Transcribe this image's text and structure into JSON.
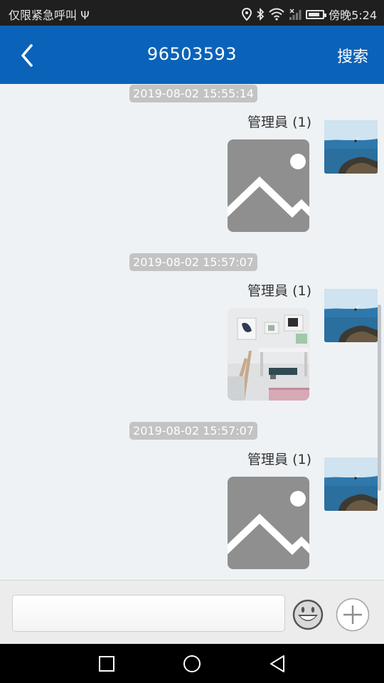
{
  "status_bar": {
    "carrier_text": "仅限紧急呼叫",
    "usb_glyph": "Ψ",
    "time_text": "傍晚5:24",
    "icons": [
      "location-icon",
      "bluetooth-icon",
      "wifi-icon",
      "cell-signal-icon",
      "battery-icon"
    ],
    "battery_level": 0.85
  },
  "header": {
    "back_icon": "chevron-left-icon",
    "title": "96503593",
    "search_label": "搜索",
    "color": "#0a63b8"
  },
  "messages": [
    {
      "timestamp": "2019-08-02 15:55:14",
      "sender": "管理員 (1)",
      "image": "placeholder-image"
    },
    {
      "timestamp": "2019-08-02 15:57:07",
      "sender": "管理員 (1)",
      "image": "room-photo"
    },
    {
      "timestamp": "2019-08-02 15:57:07",
      "sender": "管理員 (1)",
      "image": "placeholder-image"
    }
  ],
  "input_bar": {
    "message_value": "",
    "emoji_icon": "smiley-icon",
    "add_icon": "plus-icon"
  },
  "nav_bar": {
    "icons": [
      "recent-apps-icon",
      "home-icon",
      "back-triangle-icon"
    ]
  }
}
